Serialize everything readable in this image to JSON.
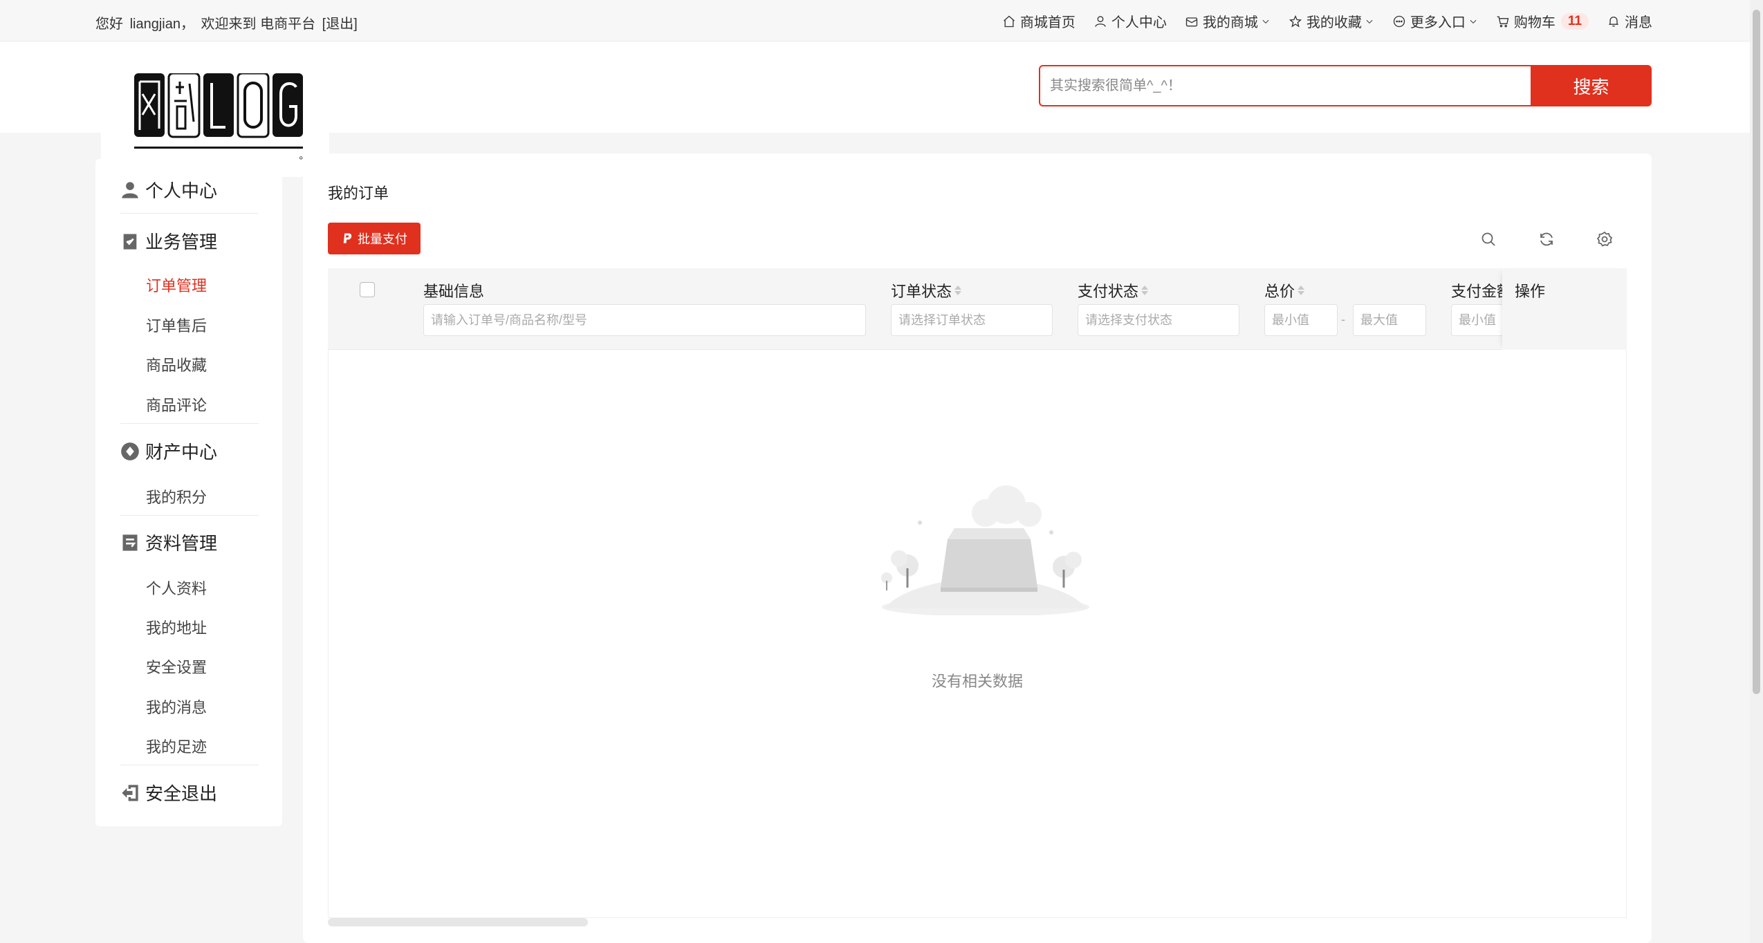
{
  "topbar": {
    "greeting_prefix": "您好",
    "username": "liangjian，",
    "welcome": "欢迎来到 电商平台",
    "logout": "[退出]",
    "nav": [
      {
        "label": "商城首页",
        "icon": "home-icon"
      },
      {
        "label": "个人中心",
        "icon": "user-icon"
      },
      {
        "label": "我的商城",
        "icon": "shop-icon"
      },
      {
        "label": "我的收藏",
        "icon": "star-icon"
      },
      {
        "label": "更多入口",
        "icon": "more-icon"
      },
      {
        "label": "购物车",
        "icon": "cart-icon",
        "badge": "11"
      },
      {
        "label": "消息",
        "icon": "bell-icon"
      }
    ]
  },
  "header": {
    "search_placeholder": "其实搜索很简单^_^！",
    "search_button": "搜索"
  },
  "sidebar": {
    "groups": [
      {
        "label": "个人中心",
        "icon": "user-icon",
        "items": []
      },
      {
        "label": "业务管理",
        "icon": "clipboard-icon",
        "items": [
          "订单管理",
          "订单售后",
          "商品收藏",
          "商品评论"
        ]
      },
      {
        "label": "财产中心",
        "icon": "coin-icon",
        "items": [
          "我的积分"
        ]
      },
      {
        "label": "资料管理",
        "icon": "archive-icon",
        "items": [
          "个人资料",
          "我的地址",
          "安全设置",
          "我的消息",
          "我的足迹"
        ]
      },
      {
        "label": "安全退出",
        "icon": "logout-icon",
        "items": []
      }
    ],
    "active_item": "订单管理"
  },
  "main": {
    "title": "我的订单",
    "batch_pay_button": "批量支付",
    "table": {
      "columns": {
        "basic_info": "基础信息",
        "order_status": "订单状态",
        "pay_status": "支付状态",
        "total_price": "总价",
        "pay_amount": "支付金额",
        "actions": "操作"
      },
      "filters": {
        "basic_info_placeholder": "请输入订单号/商品名称/型号",
        "order_status_placeholder": "请选择订单状态",
        "pay_status_placeholder": "请选择支付状态",
        "min_placeholder": "最小值",
        "max_placeholder": "最大值",
        "range_separator": "-"
      },
      "empty_text": "没有相关数据"
    }
  },
  "colors": {
    "accent": "#e0301e",
    "badge_bg": "#fde8e6"
  }
}
